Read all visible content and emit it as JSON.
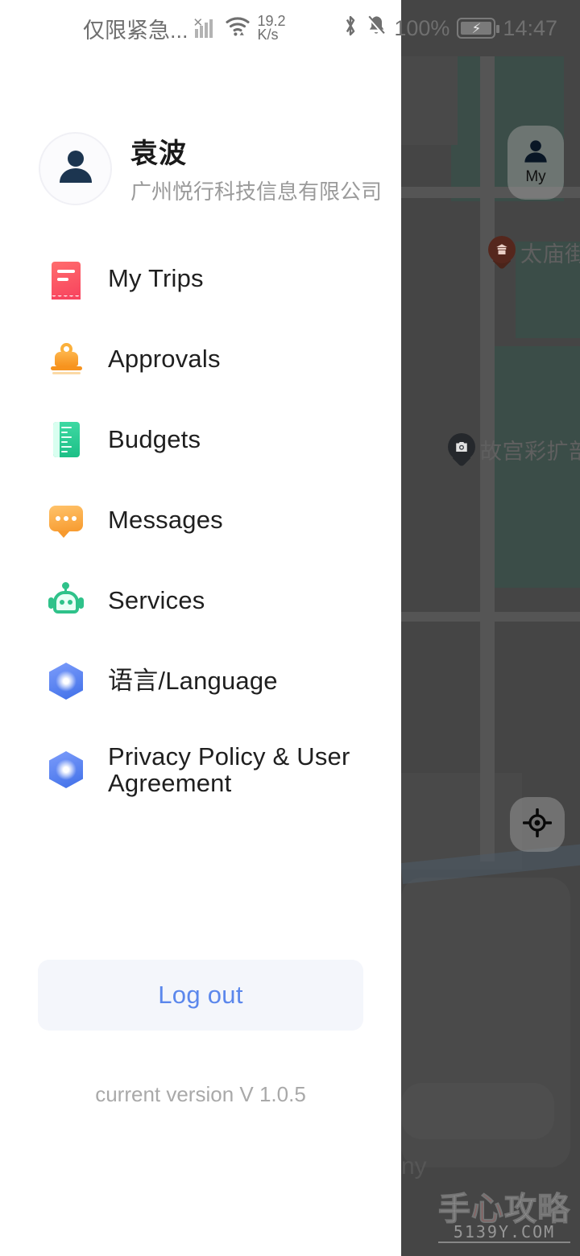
{
  "status_bar": {
    "carrier": "仅限紧急...",
    "signal_icon": "signal-bars-no-service-icon",
    "wifi_icon": "wifi-icon",
    "network_speed_value": "19.2",
    "network_speed_unit": "K/s",
    "bluetooth_icon": "bluetooth-icon",
    "silent_icon": "bell-muted-icon",
    "battery_percent": "100%",
    "battery_icon": "battery-charging-icon",
    "time": "14:47"
  },
  "drawer": {
    "profile": {
      "avatar_icon": "person-avatar-icon",
      "name": "袁波",
      "organization": "广州悦行科技信息有限公司"
    },
    "menu_items": [
      {
        "label": "My Trips",
        "icon": "receipt-icon",
        "color": "#f8455f"
      },
      {
        "label": "Approvals",
        "icon": "stamp-icon",
        "color": "#f7931e"
      },
      {
        "label": "Budgets",
        "icon": "ruler-icon",
        "color": "#1cbf86"
      },
      {
        "label": "Messages",
        "icon": "chat-bubble-icon",
        "color": "#f79a2e"
      },
      {
        "label": "Services",
        "icon": "robot-icon",
        "color": "#2fc28a"
      },
      {
        "label": "语言/Language",
        "icon": "hexagon-icon",
        "color": "#3f6fe8"
      },
      {
        "label": "Privacy Policy & User Agreement",
        "icon": "hexagon-icon",
        "color": "#3f6fe8"
      }
    ],
    "logout_label": "Log out",
    "logout_color": "#5b87ec",
    "version_text": "current version V 1.0.5"
  },
  "map": {
    "my_button": {
      "label": "My",
      "icon": "person-icon"
    },
    "locate_button": {
      "icon": "crosshair-locate-icon"
    },
    "pois": [
      {
        "name": "太庙街",
        "icon": "temple-pin-icon",
        "color": "#7a3b2b"
      },
      {
        "name": "故宫彩扩部",
        "icon": "camera-pin-icon",
        "color": "#3d4248"
      }
    ],
    "card_text": "ny",
    "watermark": {
      "title": "手心攻略",
      "url": "5139Y.COM"
    }
  }
}
